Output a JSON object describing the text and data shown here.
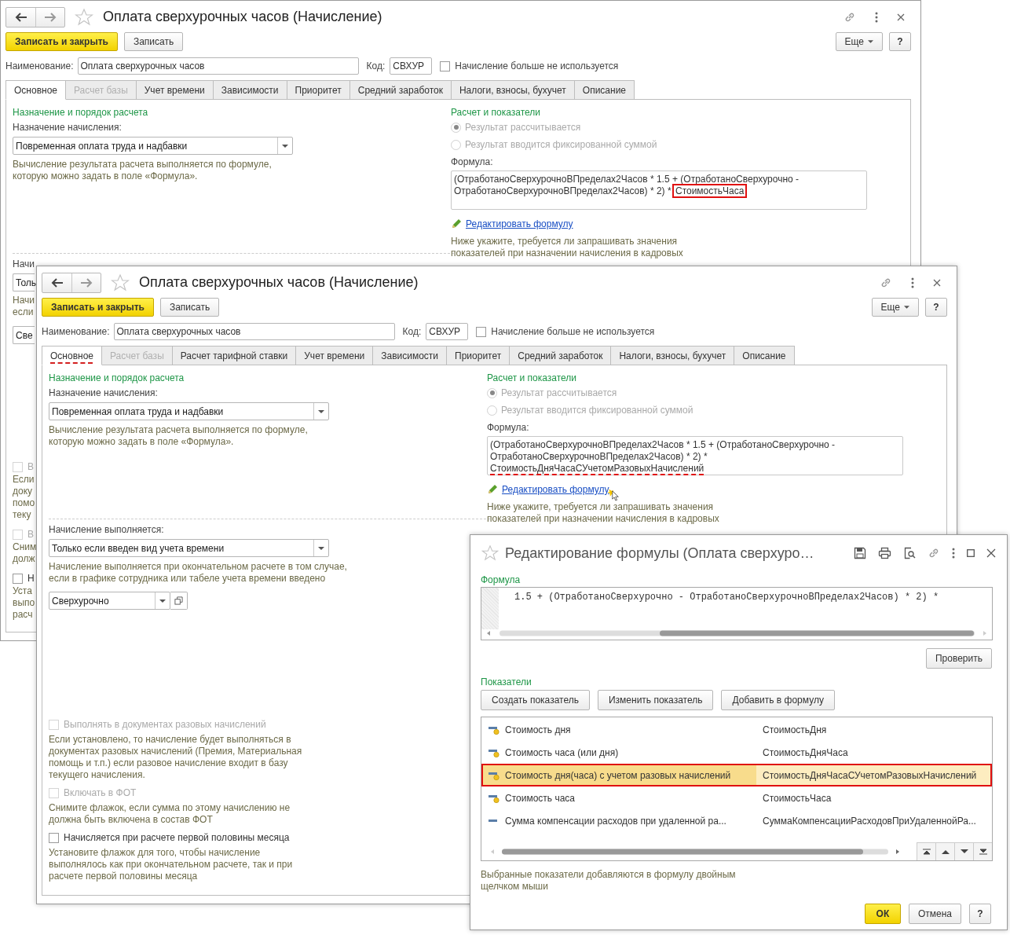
{
  "back_form": {
    "title": "Оплата сверхурочных часов (Начисление)",
    "save_close": "Записать и закрыть",
    "save": "Записать",
    "more": "Еще",
    "help": "?",
    "name_label": "Наименование:",
    "name_value": "Оплата сверхурочных часов",
    "code_label": "Код:",
    "code_value": "СВХУР",
    "unused": {
      "label": "Начисление больше не используется",
      "checked": false
    },
    "tabs": [
      {
        "label": "Основное",
        "selected": true,
        "disabled": false,
        "annotated": false
      },
      {
        "label": "Расчет базы",
        "selected": false,
        "disabled": true,
        "annotated": false
      },
      {
        "label": "Учет времени",
        "selected": false,
        "disabled": false,
        "annotated": false
      },
      {
        "label": "Зависимости",
        "selected": false,
        "disabled": false,
        "annotated": false
      },
      {
        "label": "Приоритет",
        "selected": false,
        "disabled": false,
        "annotated": false
      },
      {
        "label": "Средний заработок",
        "selected": false,
        "disabled": false,
        "annotated": false
      },
      {
        "label": "Налоги, взносы, бухучет",
        "selected": false,
        "disabled": false,
        "annotated": false
      },
      {
        "label": "Описание",
        "selected": false,
        "disabled": false,
        "annotated": false
      }
    ],
    "purpose": {
      "heading": "Назначение и порядок расчета",
      "label": "Назначение начисления:",
      "value": "Повременная оплата труда и надбавки",
      "hint_lines": [
        "Вычисление результата расчета выполняется по формуле,",
        "которую можно задать в поле «Формула»."
      ]
    },
    "calc": {
      "heading": "Расчет и показатели",
      "radios": [
        {
          "label": "Результат рассчитывается",
          "selected": true,
          "disabled": true
        },
        {
          "label": "Результат вводится фиксированной суммой",
          "selected": false,
          "disabled": true
        }
      ],
      "formula_label": "Формула:",
      "formula": [
        {
          "text": "(ОтработаноСверхурочноВПределах2Часов * 1.5 + (ОтработаноСверхурочно - ОтработаноСверхурочноВПределах2Часов) * 2) * ",
          "boxed": false,
          "underlined": false
        },
        {
          "text": "СтоимостьЧаса",
          "boxed": true,
          "underlined": false
        }
      ],
      "edit_link": "Редактировать формулу",
      "hint_lines": [
        "Ниже укажите, требуется ли запрашивать значения",
        "показателей при назначении начисления в кадровых"
      ]
    },
    "fragments_upper": [
      {
        "kind": "label",
        "text": "Начи"
      },
      {
        "kind": "select",
        "text": "Толь"
      },
      {
        "kind": "hint",
        "lines": [
          "Начи",
          "если"
        ]
      },
      {
        "kind": "select",
        "text": "Све"
      }
    ],
    "fragments_lower": [
      {
        "kind": "checkbox",
        "text": "В",
        "checked": false,
        "disabled": true
      },
      {
        "kind": "hint",
        "lines": [
          "Если",
          "доку",
          "помо",
          "теку"
        ]
      },
      {
        "kind": "checkbox",
        "text": "В",
        "checked": false,
        "disabled": true
      },
      {
        "kind": "hint",
        "lines": [
          "Сним",
          "долж"
        ]
      },
      {
        "kind": "checkbox",
        "text": "Н",
        "checked": false,
        "disabled": false
      },
      {
        "kind": "hint",
        "lines": [
          "Уста",
          "выпо",
          "расч"
        ]
      }
    ]
  },
  "front_form": {
    "title": "Оплата сверхурочных часов (Начисление)",
    "save_close": "Записать и закрыть",
    "save": "Записать",
    "more": "Еще",
    "help": "?",
    "name_label": "Наименование:",
    "name_value": "Оплата сверхурочных часов",
    "code_label": "Код:",
    "code_value": "СВХУР",
    "unused": {
      "label": "Начисление больше не используется",
      "checked": false
    },
    "tabs": [
      {
        "label": "Основное",
        "selected": true,
        "disabled": false,
        "annotated": true
      },
      {
        "label": "Расчет базы",
        "selected": false,
        "disabled": true,
        "annotated": false
      },
      {
        "label": "Расчет тарифной ставки",
        "selected": false,
        "disabled": false,
        "annotated": false
      },
      {
        "label": "Учет времени",
        "selected": false,
        "disabled": false,
        "annotated": false
      },
      {
        "label": "Зависимости",
        "selected": false,
        "disabled": false,
        "annotated": false
      },
      {
        "label": "Приоритет",
        "selected": false,
        "disabled": false,
        "annotated": false
      },
      {
        "label": "Средний заработок",
        "selected": false,
        "disabled": false,
        "annotated": false
      },
      {
        "label": "Налоги, взносы, бухучет",
        "selected": false,
        "disabled": false,
        "annotated": false
      },
      {
        "label": "Описание",
        "selected": false,
        "disabled": false,
        "annotated": false
      }
    ],
    "purpose": {
      "heading": "Назначение и порядок расчета",
      "label": "Назначение начисления:",
      "value": "Повременная оплата труда и надбавки",
      "hint_lines": [
        "Вычисление результата расчета выполняется по формуле,",
        "которую можно задать в поле «Формула»."
      ]
    },
    "calc": {
      "heading": "Расчет и показатели",
      "radios": [
        {
          "label": "Результат рассчитывается",
          "selected": true,
          "disabled": true
        },
        {
          "label": "Результат вводится фиксированной суммой",
          "selected": false,
          "disabled": true
        }
      ],
      "formula_label": "Формула:",
      "formula": [
        {
          "text": "(ОтработаноСверхурочноВПределах2Часов * 1.5 + (ОтработаноСверхурочно - ОтработаноСверхурочноВПределах2Часов) * 2) * ",
          "boxed": false,
          "underlined": false
        },
        {
          "text": "СтоимостьДняЧасаСУчетомРазовыхНачислений",
          "boxed": false,
          "underlined": true
        }
      ],
      "edit_link": "Редактировать формулу",
      "hint_lines": [
        "Ниже укажите, требуется ли запрашивать значения",
        "показателей при назначении начисления в кадровых"
      ]
    },
    "execution": {
      "label": "Начисление выполняется:",
      "value": "Только если введен вид учета времени",
      "hint_lines": [
        "Начисление выполняется при окончательном расчете в том случае,",
        "если в графике сотрудника или табеле учета времени введено"
      ],
      "time_kind": "Сверхурочно"
    },
    "options": [
      {
        "label": "Выполнять в документах разовых начислений",
        "checked": false,
        "disabled": true,
        "hint_lines": [
          "Если установлено, то начисление будет выполняться в",
          "документах разовых начислений (Премия, Материальная",
          "помощь и т.п.) если разовое начисление входит в базу",
          "текущего начисления."
        ]
      },
      {
        "label": "Включать в ФОТ",
        "checked": false,
        "disabled": true,
        "hint_lines": [
          "Снимите флажок, если сумма по этому начислению не",
          "должна быть включена в состав ФОТ"
        ]
      },
      {
        "label": "Начисляется при расчете первой половины месяца",
        "checked": false,
        "disabled": false,
        "hint_lines": [
          "Установите флажок для того, чтобы начисление",
          "выполнялось как при окончательном расчете, так и при",
          "расчете первой половины месяца"
        ]
      }
    ]
  },
  "formula_dialog": {
    "title": "Редактирование формулы (Оплата сверхуро…",
    "formula_heading": "Формула",
    "code": "1.5 + (ОтработаноСверхурочно - ОтработаноСверхурочноВПределах2Часов) * 2) *",
    "check": "Проверить",
    "indicators_heading": "Показатели",
    "actions": [
      "Создать показатель",
      "Изменить показатель",
      "Добавить в формулу"
    ],
    "rows": [
      {
        "name": "Стоимость дня",
        "id": "СтоимостьДня",
        "kind": "calculated",
        "selected": false,
        "annotated": false
      },
      {
        "name": "Стоимость часа (или дня)",
        "id": "СтоимостьДняЧаса",
        "kind": "calculated",
        "selected": false,
        "annotated": false
      },
      {
        "name": "Стоимость дня(часа) с учетом разовых начислений",
        "id": "СтоимостьДняЧасаСУчетомРазовыхНачислений",
        "kind": "calculated",
        "selected": true,
        "annotated": true
      },
      {
        "name": "Стоимость часа",
        "id": "СтоимостьЧаса",
        "kind": "calculated",
        "selected": false,
        "annotated": false
      },
      {
        "name": "Сумма компенсации расходов при удаленной ра...",
        "id": "СуммаКомпенсацииРасходовПриУдаленнойРа...",
        "kind": "plain",
        "selected": false,
        "annotated": false
      }
    ],
    "hint": "Выбранные показатели добавляются в формулу двойным щелчком мыши",
    "ok": "ОК",
    "cancel": "Отмена",
    "help": "?"
  }
}
